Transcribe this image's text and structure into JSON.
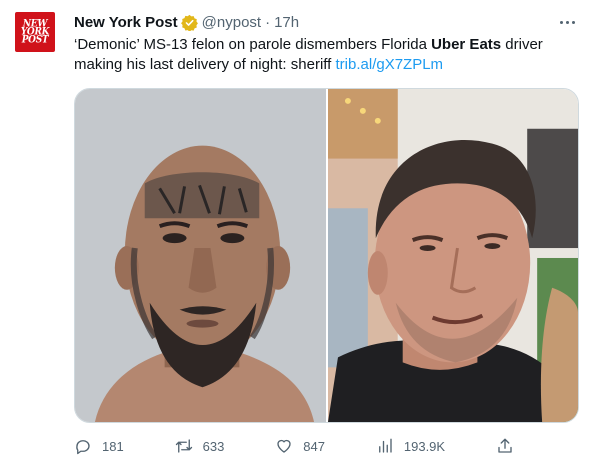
{
  "account": {
    "avatar_text": [
      "NEW",
      "YORK",
      "POST"
    ],
    "name": "New York Post",
    "handle": "@nypost",
    "separator": "·",
    "time": "17h",
    "verified_badge": "gold-verified-badge"
  },
  "tweet": {
    "text_part1": "‘Demonic’ MS-13 felon on parole dismembers Florida ",
    "text_bold": "Uber Eats",
    "text_part2": " driver making his last delivery of night: sheriff ",
    "link": "trib.al/gX7ZPLm"
  },
  "media": {
    "left_photo": "mugshot-photo",
    "right_photo": "victim-selfie-photo"
  },
  "actions": {
    "replies": "181",
    "retweets": "633",
    "likes": "847",
    "views": "193.9K",
    "share": ""
  },
  "colors": {
    "brand": "#d0121a",
    "link": "#1d9bf0",
    "secondary_text": "#536471",
    "badge": "#e2b719"
  }
}
